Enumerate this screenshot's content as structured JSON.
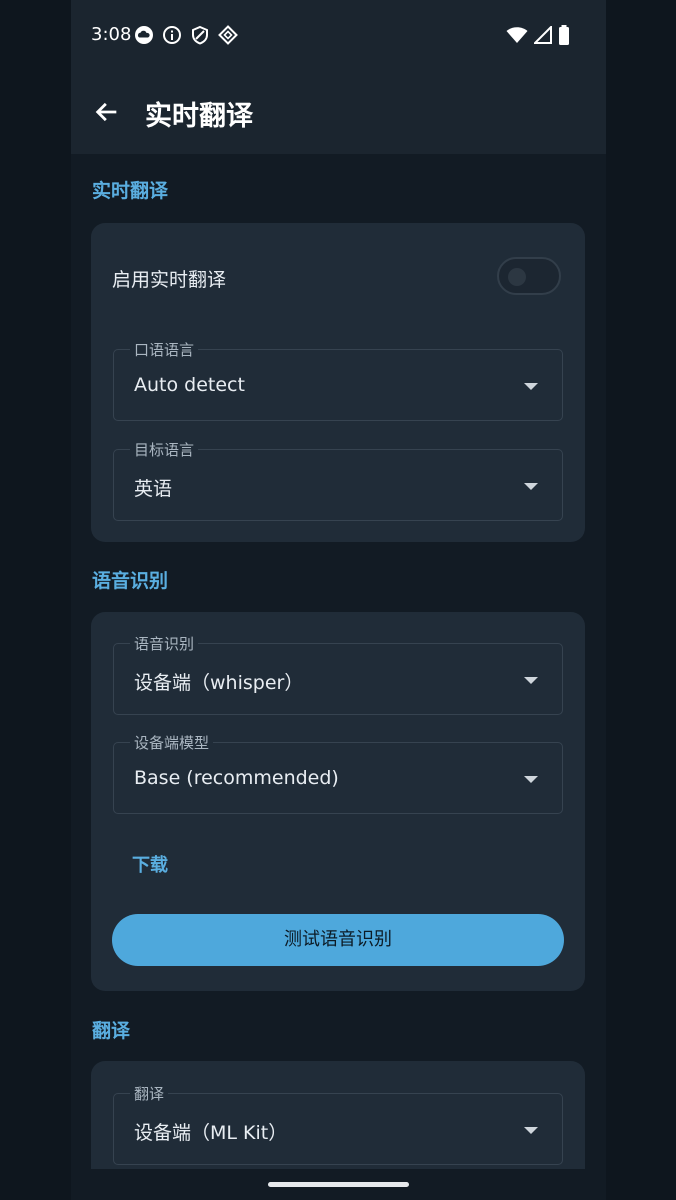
{
  "status_bar": {
    "time": "3:08",
    "left_icons": [
      "cloud-icon",
      "info-icon",
      "shield-icon",
      "vpn-diamond-icon"
    ],
    "right_icons": [
      "wifi-icon",
      "signal-icon",
      "battery-icon"
    ]
  },
  "app_bar": {
    "title": "实时翻译",
    "back_icon": "arrow-left-icon"
  },
  "sections": {
    "live_translate": {
      "header": "实时翻译",
      "toggle_label": "启用实时翻译",
      "toggle_on": false,
      "spoken_language": {
        "label": "口语语言",
        "value": "Auto detect"
      },
      "target_language": {
        "label": "目标语言",
        "value": "英语"
      }
    },
    "speech_recognition": {
      "header": "语音识别",
      "engine": {
        "label": "语音识别",
        "value": "设备端（whisper）"
      },
      "model": {
        "label": "设备端模型",
        "value": "Base (recommended)"
      },
      "download_link": "下载",
      "test_button": "测试语音识别"
    },
    "translation": {
      "header": "翻译",
      "engine": {
        "label": "翻译",
        "value": "设备端（ML Kit）"
      }
    }
  },
  "colors": {
    "background": "#0e161e",
    "card": "#202c38",
    "accent": "#5aaee0",
    "button": "#4ea8dc"
  }
}
